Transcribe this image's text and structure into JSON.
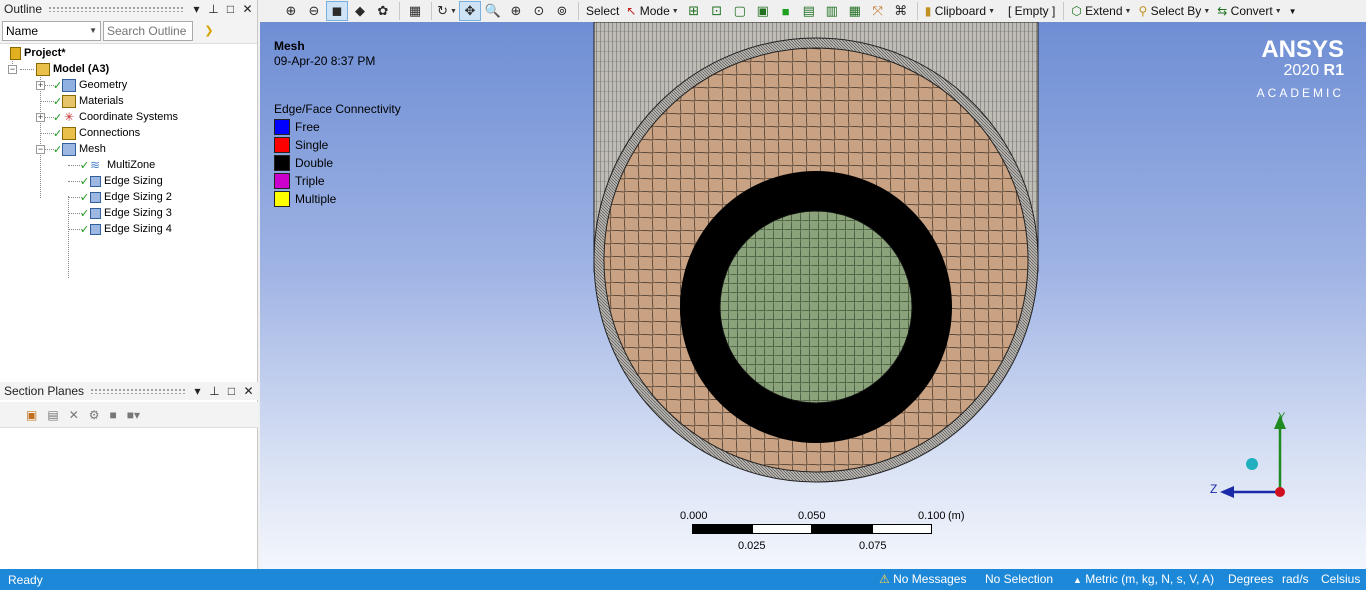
{
  "outline": {
    "title": "Outline",
    "filter_value": "Name",
    "search_placeholder": "Search Outline",
    "tree": [
      {
        "label": "Project*"
      },
      {
        "label": "Model (A3)"
      },
      {
        "label": "Geometry"
      },
      {
        "label": "Materials"
      },
      {
        "label": "Coordinate Systems"
      },
      {
        "label": "Connections"
      },
      {
        "label": "Mesh"
      },
      {
        "label": "MultiZone"
      },
      {
        "label": "Edge Sizing"
      },
      {
        "label": "Edge Sizing 2"
      },
      {
        "label": "Edge Sizing 3"
      },
      {
        "label": "Edge Sizing 4"
      }
    ]
  },
  "section_planes": {
    "title": "Section Planes"
  },
  "toolbar": {
    "select": "Select",
    "mode": "Mode",
    "clipboard": "Clipboard",
    "empty": "[ Empty ]",
    "extend": "Extend",
    "select_by": "Select By",
    "convert": "Convert"
  },
  "viewport": {
    "title": "Mesh",
    "date": "09-Apr-20 8:37 PM",
    "legend_title": "Edge/Face Connectivity",
    "legend": [
      {
        "label": "Free",
        "color": "#0000ff"
      },
      {
        "label": "Single",
        "color": "#ff0000"
      },
      {
        "label": "Double",
        "color": "#000000"
      },
      {
        "label": "Triple",
        "color": "#cc00cc"
      },
      {
        "label": "Multiple",
        "color": "#ffff00"
      }
    ],
    "logo": {
      "brand": "ANSYS",
      "version": "2020",
      "release": "R1",
      "edition": "ACADEMIC"
    },
    "scale": {
      "t0": "0.000",
      "t1": "0.050",
      "t2": "0.100",
      "unit": "(m)",
      "b1": "0.025",
      "b2": "0.075"
    },
    "axes": {
      "y": "Y",
      "z": "Z"
    },
    "colors": {
      "outer_ring": "#c9a283",
      "inner_core": "#8aa37a",
      "black_ring": "#000000"
    }
  },
  "status": {
    "ready": "Ready",
    "messages": "No Messages",
    "selection": "No Selection",
    "units": "Metric (m, kg, N, s, V, A)",
    "angle": "Degrees",
    "rate": "rad/s",
    "temp": "Celsius"
  }
}
